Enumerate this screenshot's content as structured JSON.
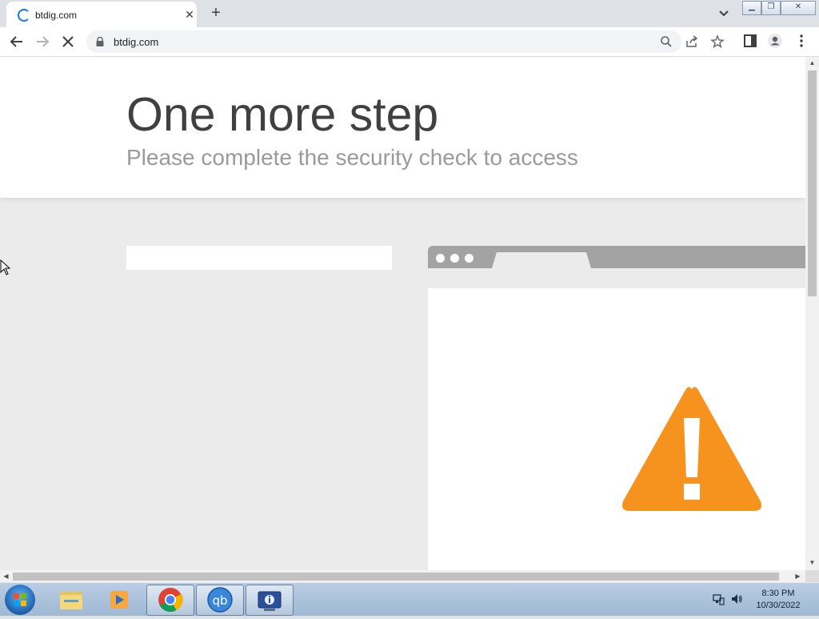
{
  "browser": {
    "tab_title": "btdig.com",
    "url": "btdig.com"
  },
  "page": {
    "title": "One more step",
    "subtitle": "Please complete the security check to access"
  },
  "taskbar": {
    "time": "8:30 PM",
    "date": "10/30/2022",
    "apps": [
      "explorer",
      "media-player",
      "chrome",
      "qbittorrent",
      "tool"
    ]
  },
  "colors": {
    "warning": "#f6931e",
    "chrome_accent": "#1a73e8"
  }
}
